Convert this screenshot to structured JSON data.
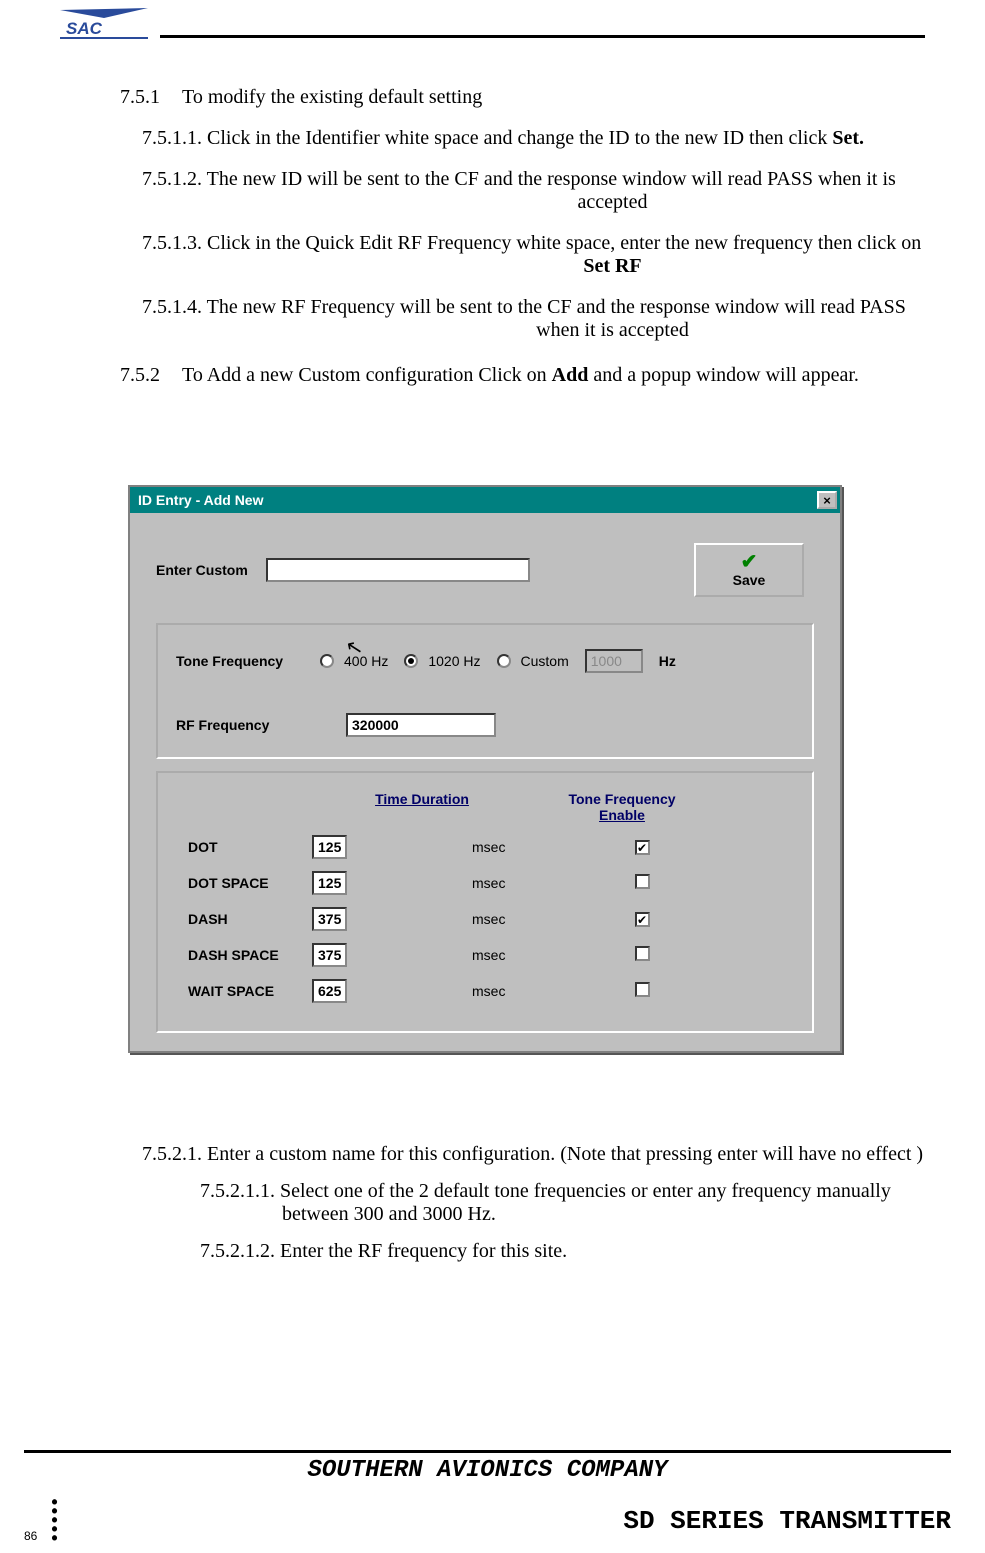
{
  "section_751_num": "7.5.1",
  "section_751_text": "To modify the existing default setting",
  "item_7511_num": "7.5.1.1.",
  "item_7511_text": " Click in the Identifier white space and change the ID to the new ID  then click ",
  "item_7511_bold": "Set.",
  "item_7512_num": "7.5.1.2.",
  "item_7512_text": " The new ID will be sent to the CF and the response window will read PASS when it is",
  "item_7512_cont": "accepted",
  "item_7513_num": "7.5.1.3.",
  "item_7513_text": " Click in the Quick Edit RF Frequency white space, enter the new frequency then click on",
  "item_7513_bold": "Set RF",
  "item_7514_num": "7.5.1.4.",
  "item_7514_text": " The new RF Frequency will be sent to the CF and the response window will read PASS",
  "item_7514_cont": "when it is accepted",
  "section_752_num": "7.5.2",
  "section_752_text_a": "To Add a new Custom configuration Click on ",
  "section_752_bold": "Add",
  "section_752_text_b": " and a popup window will appear.",
  "dialog": {
    "title": "ID Entry - Add New",
    "enter_custom_label": "Enter Custom",
    "enter_custom_value": "",
    "save_label": "Save",
    "tone_freq_label": "Tone Frequency",
    "radio_400": "400 Hz",
    "radio_1020": "1020 Hz",
    "radio_custom": "Custom",
    "custom_hz_value": "1000",
    "hz_suffix": "Hz",
    "rf_label": "RF Frequency",
    "rf_value": "320000",
    "col_time": "Time Duration",
    "col_enable_l1": "Tone Frequency",
    "col_enable_l2": "Enable",
    "unit": "msec",
    "rows": [
      {
        "name": "DOT",
        "value": "125",
        "checked": true
      },
      {
        "name": "DOT SPACE",
        "value": "125",
        "checked": false
      },
      {
        "name": "DASH",
        "value": "375",
        "checked": true
      },
      {
        "name": "DASH SPACE",
        "value": "375",
        "checked": false
      },
      {
        "name": "WAIT SPACE",
        "value": "625",
        "checked": false
      }
    ]
  },
  "item_7521_num": "7.5.2.1.",
  "item_7521_text": " Enter a custom name for this configuration. (Note that pressing enter will have no effect )",
  "item_75211_num": "7.5.2.1.1.",
  "item_75211_text_a": " Select one of the 2 default tone frequencies or enter any frequency manually",
  "item_75211_text_b": "between 300 and 3000 Hz.",
  "item_75212_num": "7.5.2.1.2.",
  "item_75212_text": " Enter the RF frequency for this site.",
  "footer_company": "SOUTHERN AVIONICS COMPANY",
  "footer_series": "SD SERIES TRANSMITTER",
  "page_number": "86"
}
